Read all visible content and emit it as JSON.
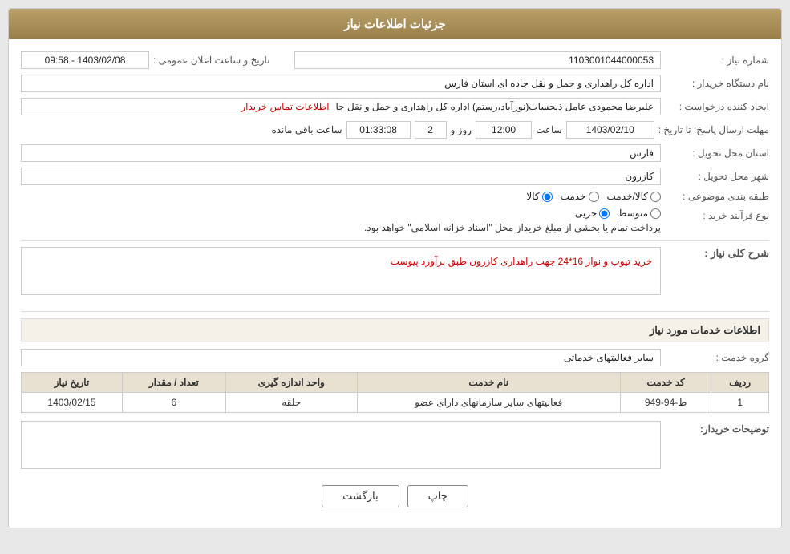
{
  "header": {
    "title": "جزئیات اطلاعات نیاز"
  },
  "fields": {
    "need_number_label": "شماره نیاز :",
    "need_number_value": "1103001044000053",
    "buyer_org_label": "نام دستگاه خریدار :",
    "buyer_org_value": "اداره کل راهداری و حمل و نقل جاده ای استان فارس",
    "creator_label": "ایجاد کننده درخواست :",
    "creator_name": "علیرضا محمودی عامل ذیحساب(نورآباد،رستم) اداره کل راهداری و حمل و نقل جا",
    "creator_link": "اطلاعات تماس خریدار",
    "reply_deadline_label": "مهلت ارسال پاسخ: تا تاریخ :",
    "reply_date": "1403/02/10",
    "reply_time_label": "ساعت",
    "reply_time": "12:00",
    "reply_days_label": "روز و",
    "reply_days": "2",
    "reply_remaining_label": "ساعت باقی مانده",
    "reply_remaining": "01:33:08",
    "province_label": "استان محل تحویل :",
    "province_value": "فارس",
    "city_label": "شهر محل تحویل :",
    "city_value": "کازرون",
    "category_label": "طبقه بندی موضوعی :",
    "category_options": [
      "کالا",
      "خدمت",
      "کالا/خدمت"
    ],
    "category_selected": "کالا",
    "purchase_type_label": "نوع فرآیند خرید :",
    "purchase_type_options": [
      "جزیی",
      "متوسط"
    ],
    "purchase_type_selected": "متوسط",
    "purchase_type_note": "پرداخت تمام یا بخشی از مبلغ خریداز محل \"اسناد خزانه اسلامی\" خواهد بود.",
    "announce_datetime_label": "تاریخ و ساعت اعلان عمومی :",
    "announce_datetime_value": "1403/02/08 - 09:58"
  },
  "description": {
    "section_label": "شرح کلی نیاز :",
    "text": "خرید تیوب و نوار 16*24 جهت راهداری کازرون طبق برآورد پیوست"
  },
  "services": {
    "section_label": "اطلاعات خدمات مورد نیاز",
    "group_label": "گروه خدمت :",
    "group_value": "سایر فعالیتهای خدماتی",
    "table": {
      "columns": [
        "ردیف",
        "کد خدمت",
        "نام خدمت",
        "واحد اندازه گیری",
        "تعداد / مقدار",
        "تاریخ نیاز"
      ],
      "rows": [
        {
          "row": "1",
          "code": "ط-94-949",
          "name": "فعالیتهای سایر سازمانهای دارای عضو",
          "unit": "حلقه",
          "quantity": "6",
          "date": "1403/02/15"
        }
      ]
    }
  },
  "buyer_notes": {
    "label": "توضیحات خریدار:",
    "text": ""
  },
  "buttons": {
    "print": "چاپ",
    "back": "بازگشت"
  }
}
